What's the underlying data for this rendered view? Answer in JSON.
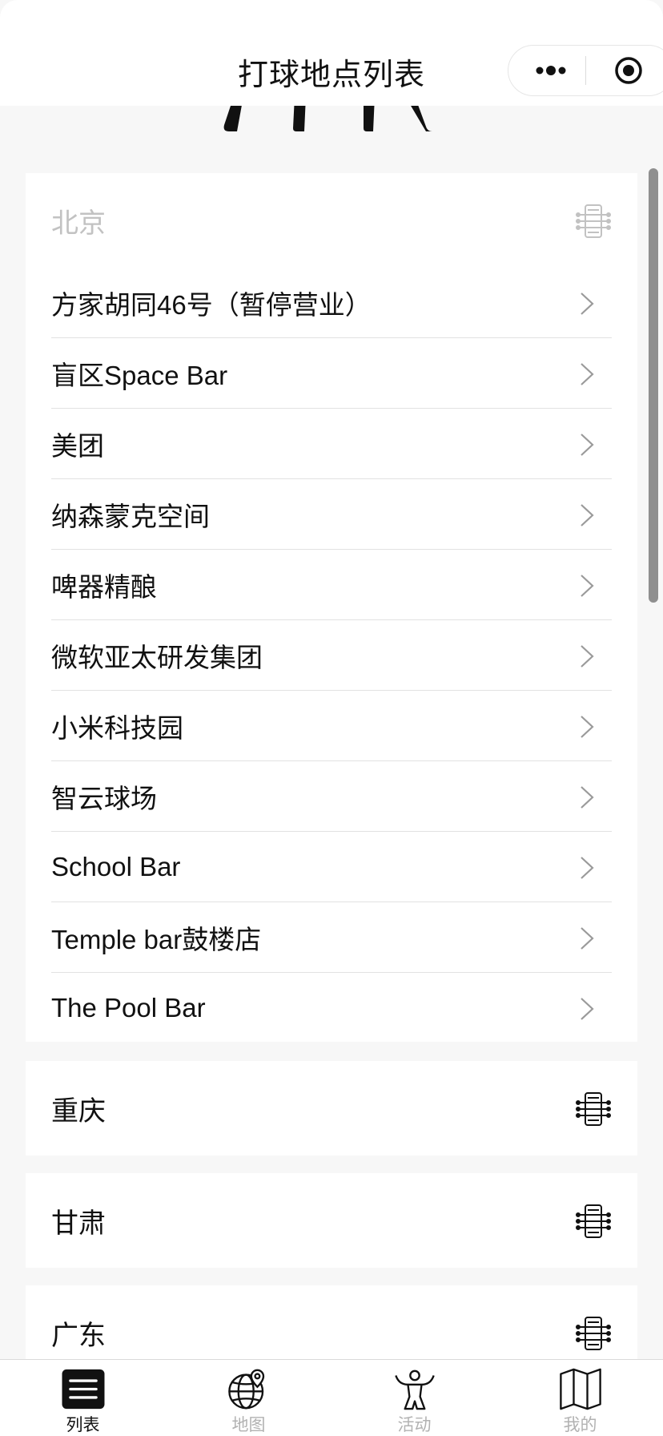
{
  "header": {
    "title": "打球地点列表"
  },
  "groups": {
    "beijing": {
      "label": "北京",
      "items": [
        "方家胡同46号（暂停营业）",
        "盲区Space Bar",
        "美团",
        "纳森蒙克空间",
        "啤器精酿",
        "微软亚太研发集团",
        "小米科技园",
        "智云球场",
        "School Bar",
        "Temple bar鼓楼店",
        "The Pool Bar"
      ]
    },
    "chongqing": {
      "label": "重庆"
    },
    "gansu": {
      "label": "甘肃"
    },
    "guangdong": {
      "label": "广东"
    }
  },
  "tabbar": {
    "list": "列表",
    "map": "地图",
    "activity": "活动",
    "mine": "我的"
  },
  "icons": {
    "group_icon": "foosball-table-icon",
    "item_arrow": "chevron-right-icon",
    "capsule_more": "more-dots-icon",
    "capsule_close": "target-close-icon"
  },
  "colors": {
    "active": "#111111",
    "inactive": "#b2b2b2",
    "muted_header": "#c2c2c2"
  }
}
